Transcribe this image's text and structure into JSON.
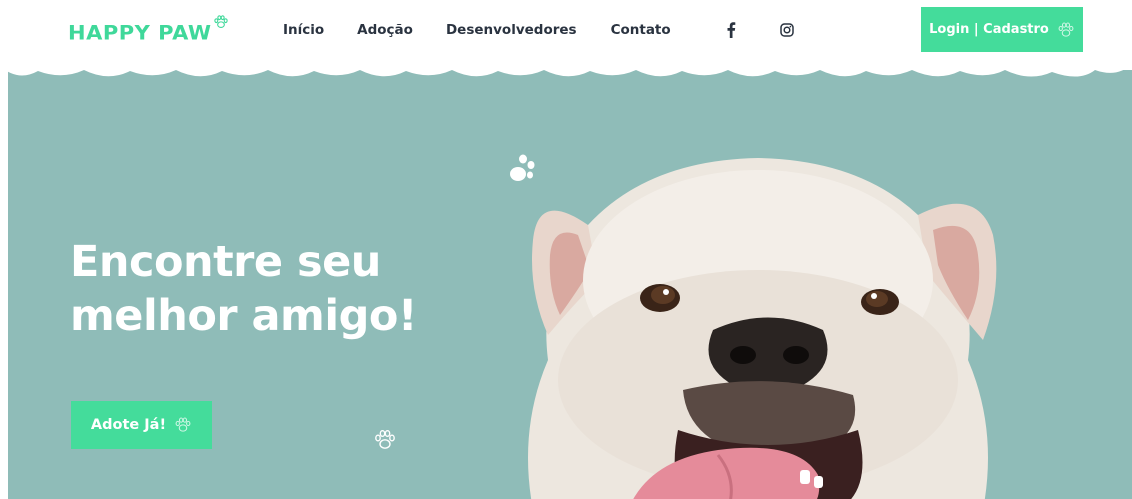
{
  "brand": {
    "logo_text": "HAPPY PAW",
    "accent_color": "#44dc9b",
    "logo_icon": "paw-outline-icon"
  },
  "nav": {
    "links": [
      {
        "label": "Início"
      },
      {
        "label": "Adoção"
      },
      {
        "label": "Desenvolvedores"
      },
      {
        "label": "Contato"
      }
    ],
    "social": [
      {
        "icon": "facebook-icon"
      },
      {
        "icon": "instagram-icon"
      }
    ],
    "login_label": "Login | Cadastro"
  },
  "hero": {
    "title_line1": "Encontre seu",
    "title_line2": "melhor amigo!",
    "cta_label": "Adote Já!",
    "background_color": "#8fbcb8",
    "image": "bulldog-photo"
  }
}
